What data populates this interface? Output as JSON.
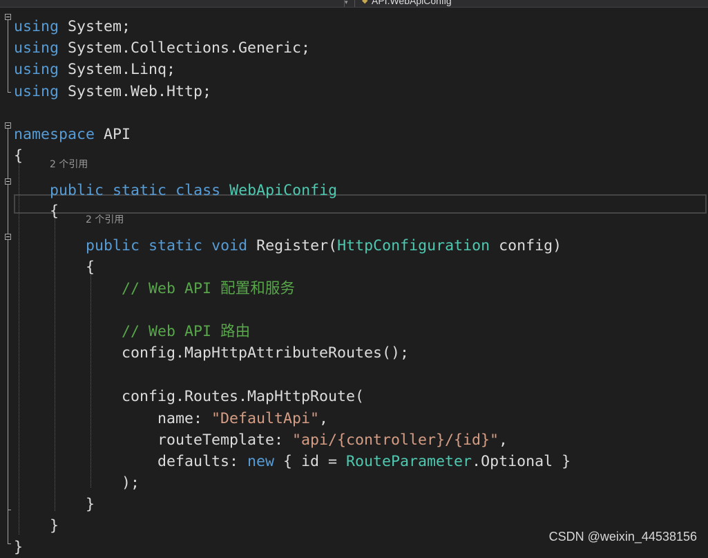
{
  "navbar": {
    "member_dropdown": "API.WebApiConfig"
  },
  "code_lens": [
    "2 个引用",
    "2 个引用"
  ],
  "lines": [
    [
      {
        "t": "using",
        "c": "kw"
      },
      {
        "t": " System;"
      }
    ],
    [
      {
        "t": "using",
        "c": "kw"
      },
      {
        "t": " System.Collections.Generic;"
      }
    ],
    [
      {
        "t": "using",
        "c": "kw"
      },
      {
        "t": " System.Linq;"
      }
    ],
    [
      {
        "t": "using",
        "c": "kw"
      },
      {
        "t": " System.Web.Http;"
      }
    ],
    [],
    [
      {
        "t": "namespace",
        "c": "kw"
      },
      {
        "t": " API"
      }
    ],
    [
      {
        "t": "{"
      }
    ],
    [
      {
        "t": "    "
      },
      {
        "t": "public",
        "c": "kw"
      },
      {
        "t": " "
      },
      {
        "t": "static",
        "c": "kw"
      },
      {
        "t": " "
      },
      {
        "t": "class",
        "c": "kw"
      },
      {
        "t": " "
      },
      {
        "t": "WebApiConfig",
        "c": "ty"
      }
    ],
    [
      {
        "t": "    {"
      }
    ],
    [
      {
        "t": "        "
      },
      {
        "t": "public",
        "c": "kw"
      },
      {
        "t": " "
      },
      {
        "t": "static",
        "c": "kw"
      },
      {
        "t": " "
      },
      {
        "t": "void",
        "c": "kw"
      },
      {
        "t": " Register("
      },
      {
        "t": "HttpConfiguration",
        "c": "ty"
      },
      {
        "t": " config)"
      }
    ],
    [
      {
        "t": "        {"
      }
    ],
    [
      {
        "t": "            "
      },
      {
        "t": "// Web API 配置和服务",
        "c": "cm"
      }
    ],
    [],
    [
      {
        "t": "            "
      },
      {
        "t": "// Web API 路由",
        "c": "cm"
      }
    ],
    [
      {
        "t": "            config.MapHttpAttributeRoutes();"
      }
    ],
    [],
    [
      {
        "t": "            config.Routes.MapHttpRoute("
      }
    ],
    [
      {
        "t": "                name: "
      },
      {
        "t": "\"DefaultApi\"",
        "c": "st"
      },
      {
        "t": ","
      }
    ],
    [
      {
        "t": "                routeTemplate: "
      },
      {
        "t": "\"api/{controller}/{id}\"",
        "c": "st"
      },
      {
        "t": ","
      }
    ],
    [
      {
        "t": "                defaults: "
      },
      {
        "t": "new",
        "c": "kw"
      },
      {
        "t": " { id = "
      },
      {
        "t": "RouteParameter",
        "c": "ty"
      },
      {
        "t": ".Optional }"
      }
    ],
    [
      {
        "t": "            );"
      }
    ],
    [
      {
        "t": "        }"
      }
    ],
    [
      {
        "t": "    }"
      }
    ],
    [
      {
        "t": "}"
      }
    ]
  ],
  "watermark": "CSDN @weixin_44538156",
  "colors": {
    "background": "#1e1e1e",
    "keyword": "#569cd6",
    "type": "#4ec9b0",
    "string": "#d69d85",
    "comment": "#57a64a",
    "plain": "#dcdcdc",
    "code_lens": "#999999"
  }
}
